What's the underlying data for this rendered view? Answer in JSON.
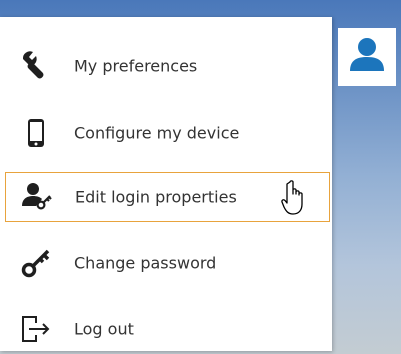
{
  "user_menu": {
    "items": [
      {
        "label": "My preferences",
        "icon": "wrench-icon"
      },
      {
        "label": "Configure my device",
        "icon": "smartphone-icon"
      },
      {
        "label": "Edit login properties",
        "icon": "user-key-icon"
      },
      {
        "label": "Change password",
        "icon": "key-icon"
      },
      {
        "label": "Log out",
        "icon": "logout-icon"
      }
    ],
    "highlighted_item": "Edit login properties"
  },
  "avatar": {
    "icon": "user-avatar-icon"
  },
  "colors": {
    "accent_border": "#e8a33d",
    "icon": "#1f1f1f",
    "avatar": "#1c75bc"
  }
}
